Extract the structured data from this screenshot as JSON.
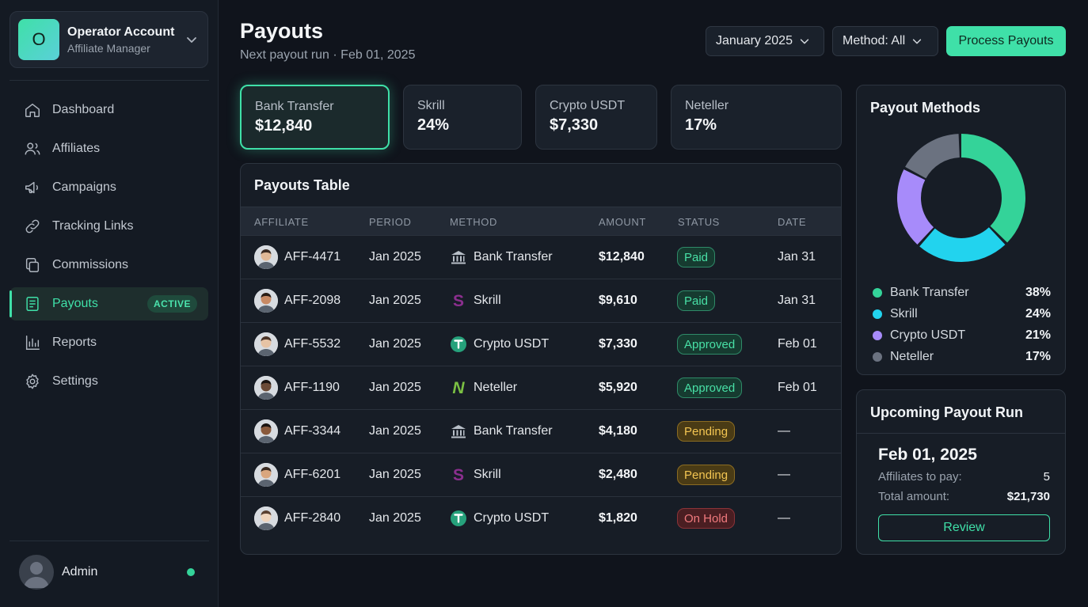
{
  "account": {
    "initial": "O",
    "name": "Operator Account",
    "role": "Affiliate Manager"
  },
  "nav": [
    {
      "label": "Dashboard",
      "icon": "home-icon"
    },
    {
      "label": "Affiliates",
      "icon": "users-icon"
    },
    {
      "label": "Campaigns",
      "icon": "megaphone-icon"
    },
    {
      "label": "Tracking Links",
      "icon": "link-icon"
    },
    {
      "label": "Commissions",
      "icon": "copy-icon"
    },
    {
      "label": "Payouts",
      "icon": "document-icon",
      "active": true,
      "badge": "ACTIVE"
    },
    {
      "label": "Reports",
      "icon": "bar-chart-icon"
    },
    {
      "label": "Settings",
      "icon": "gear-icon"
    }
  ],
  "user": {
    "name": "Admin",
    "status_color": "#34d399"
  },
  "header": {
    "title": "Payouts",
    "subtitle": "Next payout run · Feb 01, 2025",
    "period_select": "January 2025",
    "method_select": "Method: All",
    "primary_button": "Process Payouts"
  },
  "stats": [
    {
      "label": "Bank Transfer",
      "value": "$12,840"
    },
    {
      "label": "Skrill",
      "value": "24%"
    },
    {
      "label": "Crypto USDT",
      "value": "$7,330"
    },
    {
      "label": "Neteller",
      "value": "17%"
    }
  ],
  "table": {
    "title": "Payouts Table",
    "columns": [
      "AFFILIATE",
      "PERIOD",
      "METHOD",
      "AMOUNT",
      "STATUS",
      "DATE"
    ],
    "rows": [
      {
        "affiliate": "AFF-4471",
        "period": "Jan 2025",
        "method": "Bank Transfer",
        "amount": "$12,840",
        "status": "Paid",
        "date": "Jan 31"
      },
      {
        "affiliate": "AFF-2098",
        "period": "Jan 2025",
        "method": "Skrill",
        "amount": "$9,610",
        "status": "Paid",
        "date": "Jan 31"
      },
      {
        "affiliate": "AFF-5532",
        "period": "Jan 2025",
        "method": "Crypto USDT",
        "amount": "$7,330",
        "status": "Approved",
        "date": "Feb 01"
      },
      {
        "affiliate": "AFF-1190",
        "period": "Jan 2025",
        "method": "Neteller",
        "amount": "$5,920",
        "status": "Approved",
        "date": "Feb 01"
      },
      {
        "affiliate": "AFF-3344",
        "period": "Jan 2025",
        "method": "Bank Transfer",
        "amount": "$4,180",
        "status": "Pending",
        "date": "—"
      },
      {
        "affiliate": "AFF-6201",
        "period": "Jan 2025",
        "method": "Skrill",
        "amount": "$2,480",
        "status": "Pending",
        "date": "—"
      },
      {
        "affiliate": "AFF-2840",
        "period": "Jan 2025",
        "method": "Crypto USDT",
        "amount": "$1,820",
        "status": "On Hold",
        "date": "—"
      }
    ]
  },
  "methods": {
    "title": "Payout Methods",
    "items": [
      {
        "name": "Bank Transfer",
        "pct": "38%",
        "value": 38,
        "color": "#34d399"
      },
      {
        "name": "Skrill",
        "pct": "24%",
        "value": 24,
        "color": "#22d3ee"
      },
      {
        "name": "Crypto USDT",
        "pct": "21%",
        "value": 21,
        "color": "#a78bfa"
      },
      {
        "name": "Neteller",
        "pct": "17%",
        "value": 17,
        "color": "#6b7280"
      }
    ]
  },
  "upcoming": {
    "title": "Upcoming Payout Run",
    "date": "Feb 01, 2025",
    "affiliates_label": "Affiliates to pay:",
    "affiliates_value": "5",
    "total_label": "Total amount:",
    "total_value": "$21,730",
    "button": "Review"
  },
  "colors": {
    "accent": "#3fe0a8",
    "background": "#10141c"
  }
}
